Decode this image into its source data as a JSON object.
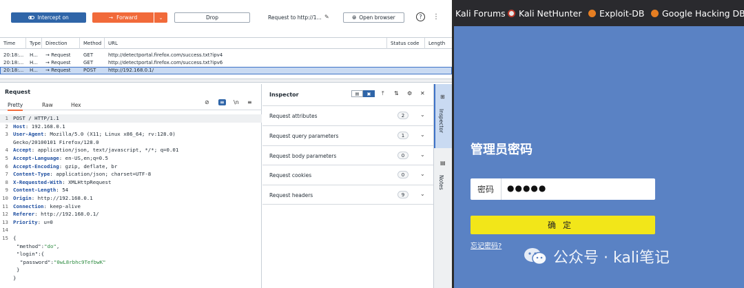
{
  "toolbar": {
    "intercept": "Intercept on",
    "forward": "Forward",
    "drop": "Drop",
    "request_to": "Request to http://1...",
    "open_browser": "Open browser"
  },
  "history": {
    "columns": [
      "Time",
      "Type",
      "Direction",
      "Method",
      "URL",
      "Status code",
      "Length"
    ],
    "rows": [
      {
        "time": "20:18:...",
        "type": "H...",
        "direction": "→  Request",
        "method": "GET",
        "url": "http://detectportal.firefox.com/success.txt?ipv4"
      },
      {
        "time": "20:18:...",
        "type": "H...",
        "direction": "→  Request",
        "method": "GET",
        "url": "http://detectportal.firefox.com/success.txt?ipv6"
      },
      {
        "time": "20:18:...",
        "type": "H...",
        "direction": "→  Request",
        "method": "POST",
        "url": "http://192.168.0.1/"
      }
    ]
  },
  "request": {
    "title": "Request",
    "tabs": [
      "Pretty",
      "Raw",
      "Hex"
    ],
    "line1": "POST / HTTP/1.1",
    "headers": [
      {
        "n": "2",
        "k": "Host",
        "v": "192.168.0.1"
      },
      {
        "n": "3",
        "k": "User-Agent",
        "v": "Mozilla/5.0 (X11; Linux x86_64; rv:128.0)"
      },
      {
        "n": "",
        "k": "",
        "v": "Gecko/20100101 Firefox/128.0"
      },
      {
        "n": "4",
        "k": "Accept",
        "v": "application/json, text/javascript, */*; q=0.01"
      },
      {
        "n": "5",
        "k": "Accept-Language",
        "v": "en-US,en;q=0.5"
      },
      {
        "n": "6",
        "k": "Accept-Encoding",
        "v": "gzip, deflate, br"
      },
      {
        "n": "7",
        "k": "Content-Type",
        "v": "application/json; charset=UTF-8"
      },
      {
        "n": "8",
        "k": "X-Requested-With",
        "v": "XMLHttpRequest"
      },
      {
        "n": "9",
        "k": "Content-Length",
        "v": "54"
      },
      {
        "n": "10",
        "k": "Origin",
        "v": "http://192.168.0.1"
      },
      {
        "n": "11",
        "k": "Connection",
        "v": "keep-alive"
      },
      {
        "n": "12",
        "k": "Referer",
        "v": "http://192.168.0.1/"
      },
      {
        "n": "13",
        "k": "Priority",
        "v": "u=0"
      }
    ],
    "body": {
      "method_key": "\"method\"",
      "method_val": "\"do\"",
      "login_key": "\"login\"",
      "password_key": "\"password\"",
      "password_val": "\"0wL8rbhc9TefbwK\""
    }
  },
  "inspector": {
    "title": "Inspector",
    "rows": [
      {
        "label": "Request attributes",
        "count": "2"
      },
      {
        "label": "Request query parameters",
        "count": "1"
      },
      {
        "label": "Request body parameters",
        "count": "0"
      },
      {
        "label": "Request cookies",
        "count": "0"
      },
      {
        "label": "Request headers",
        "count": "9"
      }
    ],
    "side_tabs": [
      "Inspector",
      "Notes"
    ]
  },
  "browser": {
    "bookmarks": [
      "Kali Forums",
      "Kali NetHunter",
      "Exploit-DB",
      "Google Hacking DB"
    ],
    "heading": "管理员密码",
    "password_label": "密码",
    "password_value": "●●●●●",
    "confirm": "确定",
    "forgot": "忘记密码?",
    "watermark": "公众号 · kali笔记"
  },
  "colors": {
    "accent_blue": "#2f65a8",
    "forward_orange": "#f16a3a",
    "page_bg": "#5a82c4",
    "confirm_yellow": "#f2e619"
  }
}
